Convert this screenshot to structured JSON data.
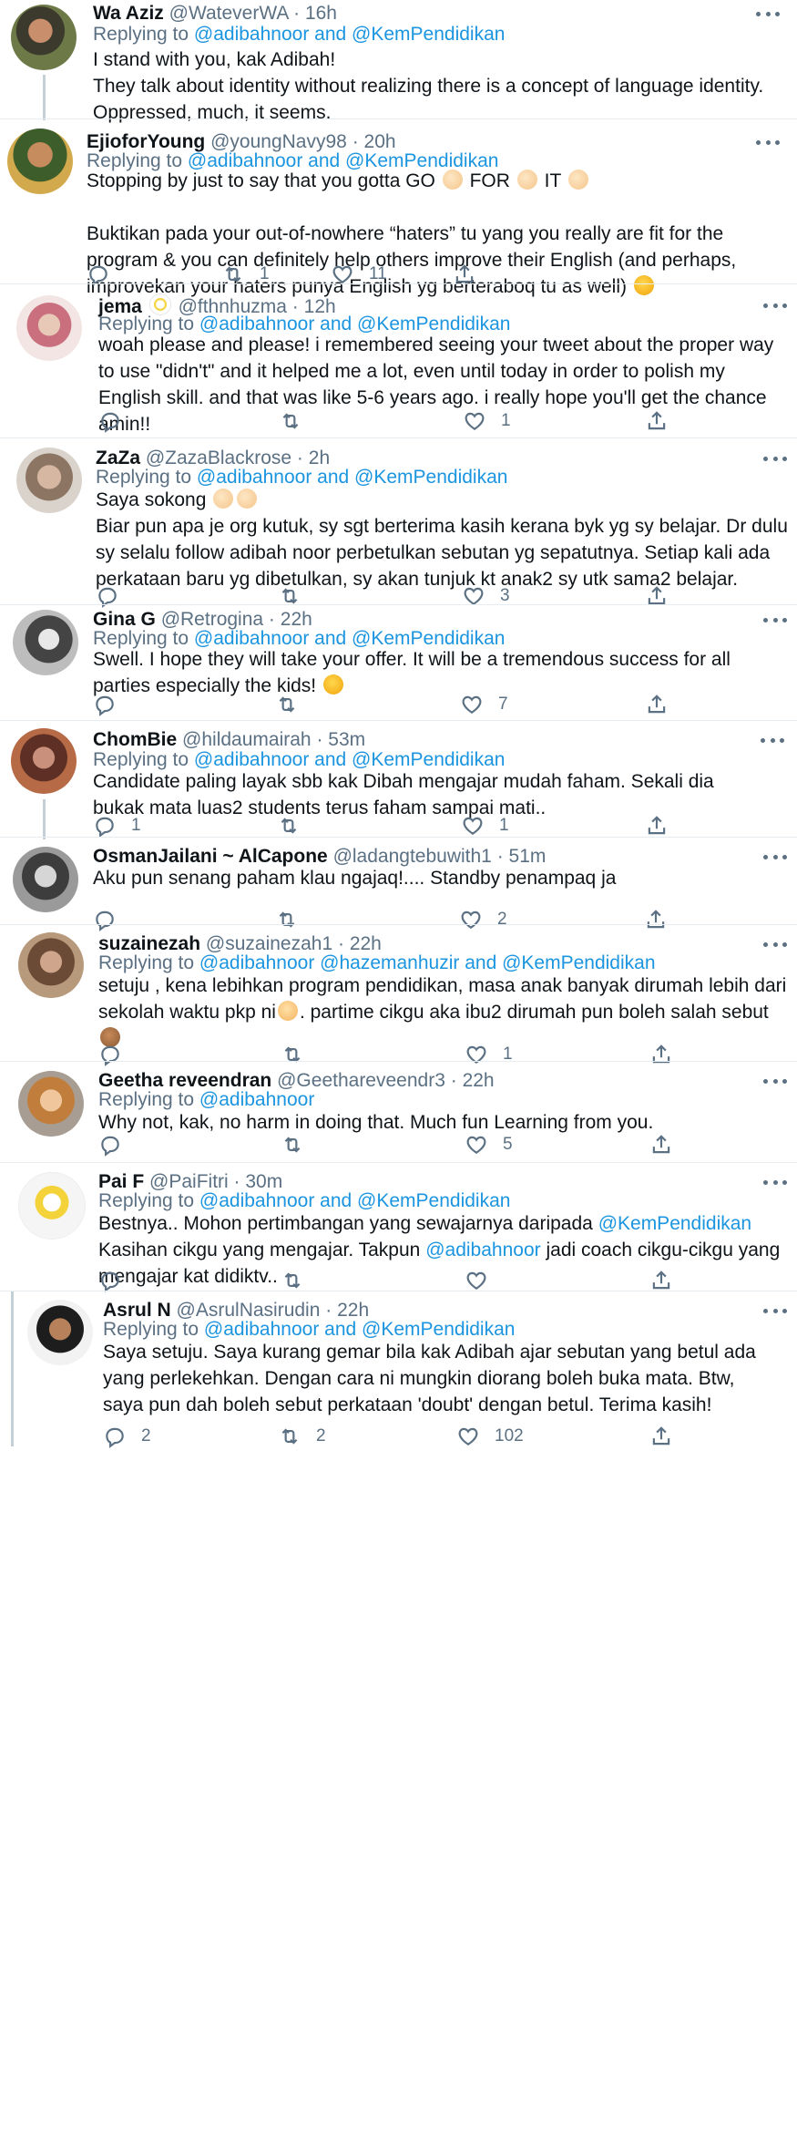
{
  "tweets": [
    {
      "name": "Wa Aziz",
      "handle": "@WateverWA",
      "time": "16h",
      "reply_prefix": "Replying to",
      "reply_to": "@adibahnoor and @KemPendidikan",
      "body": "I stand with you, kak Adibah!\nThey talk about identity without realizing there is a concept of language identity.\nOppressed, much, it seems."
    },
    {
      "name": "EjioforYoung",
      "handle": "@youngNavy98",
      "time": "20h",
      "reply_prefix": "Replying to",
      "reply_to": "@adibahnoor and @KemPendidikan",
      "body_l1a": "Stopping by just to say that you gotta GO",
      "body_l1b": "FOR",
      "body_l1c": "IT",
      "body_rest": "Buktikan pada your out-of-nowhere “haters” tu yang you really are fit for the program & you can definitely help others improve their English (and perhaps, improvekan your haters punya English yg berteraboq tu as well)",
      "replies": "",
      "retweets": "1",
      "likes": "11"
    },
    {
      "name": "jema",
      "handle": "@fthnhuzma",
      "time": "12h",
      "reply_prefix": "Replying to",
      "reply_to": "@adibahnoor and @KemPendidikan",
      "body": "woah please and please! i remembered seeing your tweet about the proper way to use \"didn't\" and it helped me a lot, even until today in order to polish my English skill. and that was like 5-6 years ago. i really hope you'll get the chance amin!!",
      "replies": "",
      "retweets": "",
      "likes": "1"
    },
    {
      "name": "ZaZa",
      "handle": "@ZazaBlackrose",
      "time": "2h",
      "reply_prefix": "Replying to",
      "reply_to": "@adibahnoor and @KemPendidikan",
      "body_l1": "Saya sokong",
      "body_rest": "Biar pun apa je org kutuk, sy sgt berterima kasih kerana byk yg sy belajar. Dr dulu sy selalu follow adibah noor perbetulkan sebutan yg sepatutnya. Setiap kali ada perkataan baru yg dibetulkan, sy akan tunjuk kt anak2 sy utk sama2 belajar.",
      "replies": "",
      "retweets": "",
      "likes": "3"
    },
    {
      "name": "Gina G",
      "handle": "@Retrogina",
      "time": "22h",
      "reply_prefix": "Replying to",
      "reply_to": "@adibahnoor and @KemPendidikan",
      "body": "Swell. I hope they will take your offer. It will be a tremendous success for all parties especially the kids!",
      "replies": "",
      "retweets": "",
      "likes": "7"
    },
    {
      "name": "ChomBie",
      "handle": "@hildaumairah",
      "time": "53m",
      "reply_prefix": "Replying to",
      "reply_to": "@adibahnoor and @KemPendidikan",
      "body": "Candidate paling layak sbb kak Dibah mengajar mudah faham. Sekali dia bukak mata luas2 students terus faham sampai mati..",
      "replies": "1",
      "retweets": "",
      "likes": "1"
    },
    {
      "name": "OsmanJailani ~ AlCapone",
      "handle": "@ladangtebuwith1",
      "time": "51m",
      "body": "Aku pun senang paham klau ngajaq!.... Standby penampaq ja",
      "replies": "",
      "retweets": "",
      "likes": "2"
    },
    {
      "name": "suzainezah",
      "handle": "@suzainezah1",
      "time": "22h",
      "reply_prefix": "Replying to",
      "reply_to": "@adibahnoor @hazemanhuzir and @KemPendidikan",
      "body_a": "setuju , kena lebihkan program pendidikan, masa anak banyak dirumah lebih dari sekolah waktu pkp ni",
      "body_b": ". partime cikgu aka ibu2 dirumah pun boleh salah sebut",
      "replies": "",
      "retweets": "",
      "likes": "1"
    },
    {
      "name": "Geetha reveendran",
      "handle": "@Geethareveendr3",
      "time": "22h",
      "reply_prefix": "Replying to",
      "reply_to": "@adibahnoor",
      "body": "Why not, kak, no harm in doing that. Much fun Learning from you.",
      "replies": "",
      "retweets": "",
      "likes": "5"
    },
    {
      "name": "Pai F",
      "handle": "@PaiFitri",
      "time": "30m",
      "reply_prefix": "Replying to",
      "reply_to": "@adibahnoor and @KemPendidikan",
      "body_a": "Bestnya.. Mohon pertimbangan yang sewajarnya daripada",
      "mention_a": "@KemPendidikan",
      "body_b": "Kasihan cikgu yang mengajar. Takpun",
      "mention_b": "@adibahnoor",
      "body_c": "jadi coach cikgu-cikgu yang mengajar kat didiktv..",
      "replies": "",
      "retweets": "",
      "likes": ""
    },
    {
      "name": "Asrul N",
      "handle": "@AsrulNasirudin",
      "time": "22h",
      "reply_prefix": "Replying to",
      "reply_to": "@adibahnoor and @KemPendidikan",
      "body": "Saya setuju. Saya kurang gemar bila kak Adibah ajar sebutan yang betul ada yang perlekehkan. Dengan cara ni mungkin diorang boleh buka mata. Btw, saya pun dah boleh sebut perkataan 'doubt' dengan betul. Terima kasih!",
      "replies": "2",
      "retweets": "2",
      "likes": "102"
    }
  ],
  "dot": "·",
  "colors": {
    "link": "#1b95e0",
    "muted": "#5b7083",
    "text": "#0f1419",
    "divider": "#e6ecf0"
  },
  "icons": [
    "reply-icon",
    "retweet-icon",
    "like-icon",
    "share-icon",
    "more-icon"
  ]
}
